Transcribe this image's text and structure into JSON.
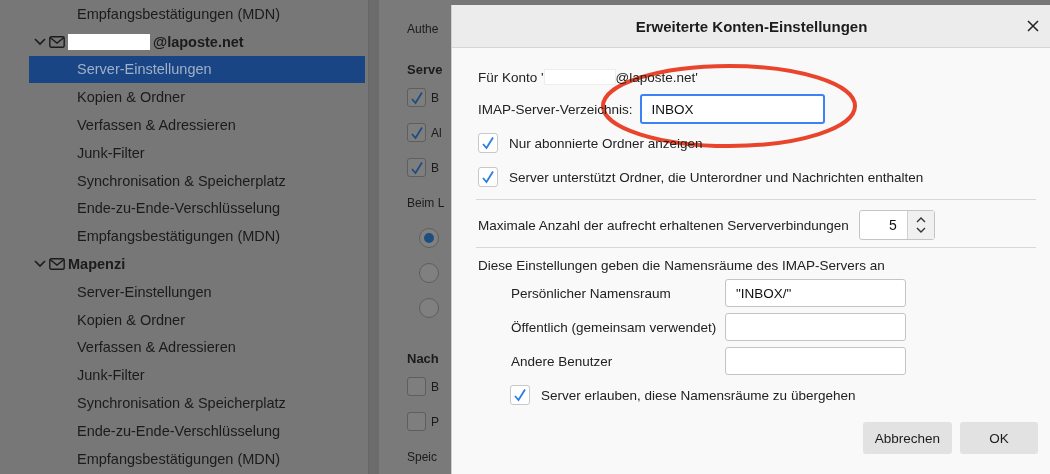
{
  "sidebar": {
    "previous_items": [
      {
        "label": "Empfangsbestätigungen (MDN)",
        "selected": false
      }
    ],
    "accounts": [
      {
        "label": "@laposte.net",
        "redacted": true,
        "expanded": true,
        "items": [
          {
            "label": "Server-Einstellungen",
            "selected": true
          },
          {
            "label": "Kopien & Ordner",
            "selected": false
          },
          {
            "label": "Verfassen & Adressieren",
            "selected": false
          },
          {
            "label": "Junk-Filter",
            "selected": false
          },
          {
            "label": "Synchronisation & Speicherplatz",
            "selected": false
          },
          {
            "label": "Ende-zu-Ende-Verschlüsselung",
            "selected": false
          },
          {
            "label": "Empfangsbestätigungen (MDN)",
            "selected": false
          }
        ]
      },
      {
        "label": "Mapenzi",
        "redacted": false,
        "expanded": true,
        "items": [
          {
            "label": "Server-Einstellungen",
            "selected": false
          },
          {
            "label": "Kopien & Ordner",
            "selected": false
          },
          {
            "label": "Verfassen & Adressieren",
            "selected": false
          },
          {
            "label": "Junk-Filter",
            "selected": false
          },
          {
            "label": "Synchronisation & Speicherplatz",
            "selected": false
          },
          {
            "label": "Ende-zu-Ende-Verschlüsselung",
            "selected": false
          },
          {
            "label": "Empfangsbestätigungen (MDN)",
            "selected": false
          }
        ]
      }
    ]
  },
  "settings_pane": {
    "top_text": "Authe",
    "sections": [
      {
        "heading": "Serve",
        "rows": [
          {
            "kind": "checkbox",
            "label": "B",
            "checked": true
          },
          {
            "kind": "checkbox",
            "label": "Al",
            "checked": true
          },
          {
            "kind": "checkbox",
            "label": "B",
            "checked": true
          },
          {
            "kind": "text",
            "label": "Beim L"
          },
          {
            "kind": "radio",
            "selected": true
          },
          {
            "kind": "radio",
            "selected": false
          },
          {
            "kind": "radio",
            "selected": false
          }
        ]
      },
      {
        "heading": "Nach",
        "rows": [
          {
            "kind": "checkbox",
            "label": "B",
            "checked": false
          },
          {
            "kind": "checkbox",
            "label": "P",
            "checked": false
          },
          {
            "kind": "text",
            "label": "Speic"
          }
        ]
      }
    ]
  },
  "dialog": {
    "title": "Erweiterte Konten-Einstellungen",
    "account_prefix": "Für Konto '",
    "account_suffix": "@laposte.net'",
    "account_redacted": true,
    "directory": {
      "label": "IMAP-Server-Verzeichnis:",
      "value": "INBOX",
      "focused": true,
      "highlighted": true
    },
    "options": [
      {
        "label": "Nur abonnierte Ordner anzeigen",
        "checked": true
      },
      {
        "label": "Server unterstützt Ordner, die Unterordner und Nachrichten enthalten",
        "checked": true
      }
    ],
    "max_connections": {
      "label": "Maximale Anzahl der aufrecht erhaltenen Serververbindungen",
      "value": "5"
    },
    "namespaces": {
      "intro": "Diese Einstellungen geben die Namensräume des IMAP-Servers an",
      "fields": [
        {
          "label": "Persönlicher Namensraum",
          "value": "\"INBOX/\""
        },
        {
          "label": "Öffentlich (gemeinsam verwendet)"
        },
        {
          "label": "Andere Benutzer"
        }
      ],
      "option": {
        "label": "Server erlauben, diese Namensräume zu übergehen",
        "checked": true
      }
    },
    "buttons": [
      {
        "label": "Abbrechen",
        "kind": "secondary"
      },
      {
        "label": "OK",
        "kind": "primary"
      }
    ]
  }
}
